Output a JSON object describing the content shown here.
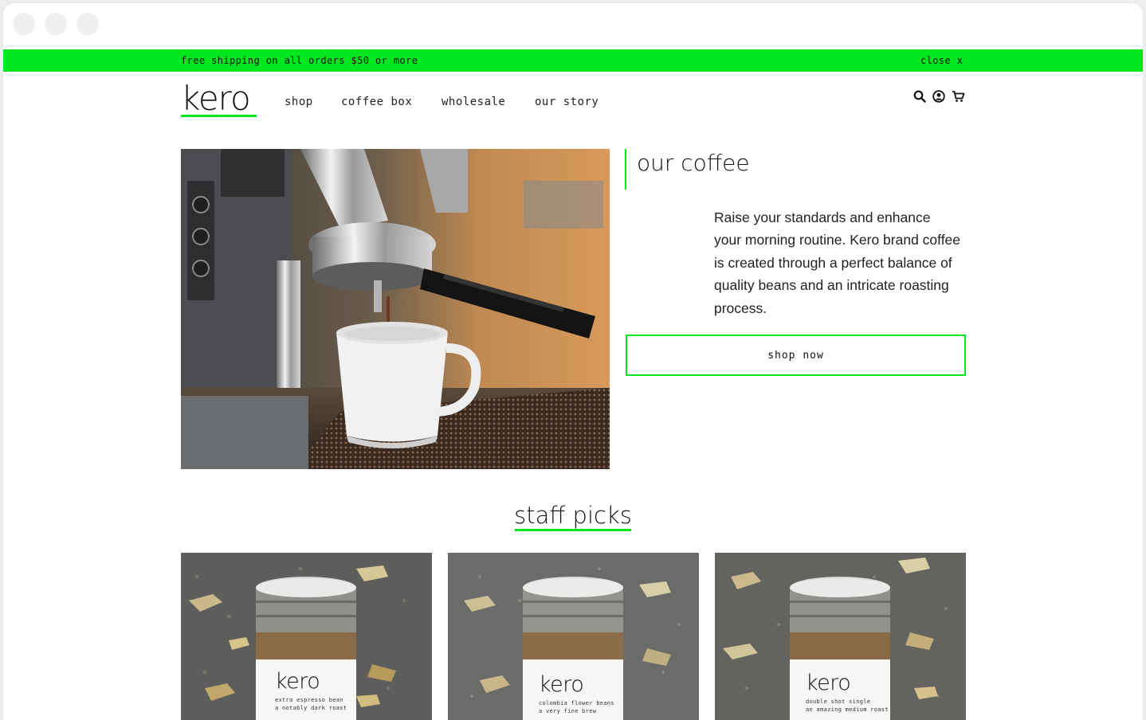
{
  "promo": {
    "text": "free shipping on all orders $50 or more",
    "close_label": "close x",
    "color": "#00e61f"
  },
  "header": {
    "logo": "kero",
    "nav": [
      {
        "label": "shop"
      },
      {
        "label": "coffee box"
      },
      {
        "label": "wholesale"
      },
      {
        "label": "our story"
      }
    ],
    "icons": [
      "search-icon",
      "account-icon",
      "cart-icon"
    ]
  },
  "hero": {
    "title": "our coffee",
    "description": "Raise your standards and enhance your morning routine. Kero brand coffee is created through a perfect balance of quality beans and an intricate roasting process.",
    "cta_label": "shop now",
    "image": "espresso-machine-pouring-into-white-cup"
  },
  "staff_picks": {
    "title": "staff picks",
    "products": [
      {
        "label_logo": "kero",
        "label_line1": "extra espresso bean",
        "label_line2": "a notably dark roast"
      },
      {
        "label_logo": "kero",
        "label_line1": "colombia flower beans",
        "label_line2": "a very fine brew"
      },
      {
        "label_logo": "kero",
        "label_line1": "double shot single",
        "label_line2": "an amazing medium roast"
      }
    ]
  },
  "colors": {
    "accent": "#00e61f",
    "text": "#111111"
  }
}
